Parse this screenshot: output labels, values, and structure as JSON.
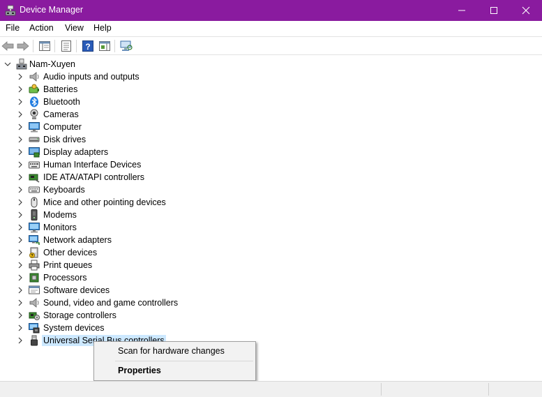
{
  "window": {
    "title": "Device Manager"
  },
  "menu": [
    "File",
    "Action",
    "View",
    "Help"
  ],
  "toolbar": [
    "back",
    "forward",
    "show-hide-console-tree",
    "properties",
    "help",
    "action-pane",
    "scan-hardware"
  ],
  "tree": {
    "root": "Nam-Xuyen",
    "items": [
      {
        "label": "Audio inputs and outputs",
        "icon": "speaker-icon"
      },
      {
        "label": "Batteries",
        "icon": "battery-icon"
      },
      {
        "label": "Bluetooth",
        "icon": "bluetooth-icon"
      },
      {
        "label": "Cameras",
        "icon": "camera-icon"
      },
      {
        "label": "Computer",
        "icon": "computer-icon"
      },
      {
        "label": "Disk drives",
        "icon": "disk-drive-icon"
      },
      {
        "label": "Display adapters",
        "icon": "display-adapter-icon"
      },
      {
        "label": "Human Interface Devices",
        "icon": "hid-icon"
      },
      {
        "label": "IDE ATA/ATAPI controllers",
        "icon": "ide-controller-icon"
      },
      {
        "label": "Keyboards",
        "icon": "keyboard-icon"
      },
      {
        "label": "Mice and other pointing devices",
        "icon": "mouse-icon"
      },
      {
        "label": "Modems",
        "icon": "modem-icon"
      },
      {
        "label": "Monitors",
        "icon": "monitor-icon"
      },
      {
        "label": "Network adapters",
        "icon": "network-adapter-icon"
      },
      {
        "label": "Other devices",
        "icon": "other-devices-icon"
      },
      {
        "label": "Print queues",
        "icon": "printer-icon"
      },
      {
        "label": "Processors",
        "icon": "processor-icon"
      },
      {
        "label": "Software devices",
        "icon": "software-device-icon"
      },
      {
        "label": "Sound, video and game controllers",
        "icon": "sound-controller-icon"
      },
      {
        "label": "Storage controllers",
        "icon": "storage-controller-icon"
      },
      {
        "label": "System devices",
        "icon": "system-devices-icon"
      },
      {
        "label": "Universal Serial Bus controllers",
        "icon": "usb-icon",
        "selected": true
      }
    ]
  },
  "context_menu": {
    "scan": "Scan for hardware changes",
    "properties": "Properties"
  },
  "colors": {
    "titlebar": "#8a1b9f",
    "selection": "#cce8ff"
  }
}
